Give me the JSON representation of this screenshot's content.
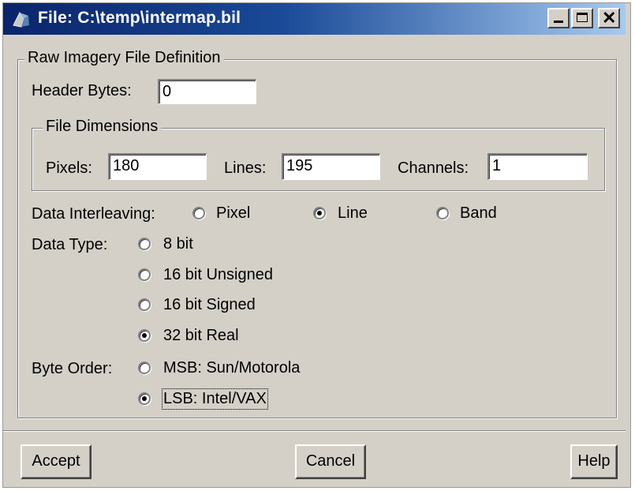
{
  "window": {
    "title": "File: C:\\temp\\intermap.bil",
    "controls": {
      "minimize": "minimize",
      "maximize": "maximize",
      "close": "close"
    }
  },
  "raw_imagery": {
    "group_title": "Raw Imagery File Definition",
    "header_bytes_label": "Header Bytes:",
    "header_bytes_value": "0"
  },
  "file_dimensions": {
    "group_title": "File Dimensions",
    "pixels_label": "Pixels:",
    "pixels_value": "180",
    "lines_label": "Lines:",
    "lines_value": "195",
    "channels_label": "Channels:",
    "channels_value": "1"
  },
  "data_interleaving": {
    "label": "Data Interleaving:",
    "options": [
      "Pixel",
      "Line",
      "Band"
    ],
    "selected": "Line"
  },
  "data_type": {
    "label": "Data Type:",
    "options": [
      "8 bit",
      "16 bit Unsigned",
      "16 bit Signed",
      "32 bit Real"
    ],
    "selected": "32 bit Real"
  },
  "byte_order": {
    "label": "Byte Order:",
    "options": [
      "MSB: Sun/Motorola",
      "LSB: Intel/VAX"
    ],
    "selected": "LSB: Intel/VAX"
  },
  "buttons": {
    "accept": "Accept",
    "cancel": "Cancel",
    "help": "Help"
  }
}
